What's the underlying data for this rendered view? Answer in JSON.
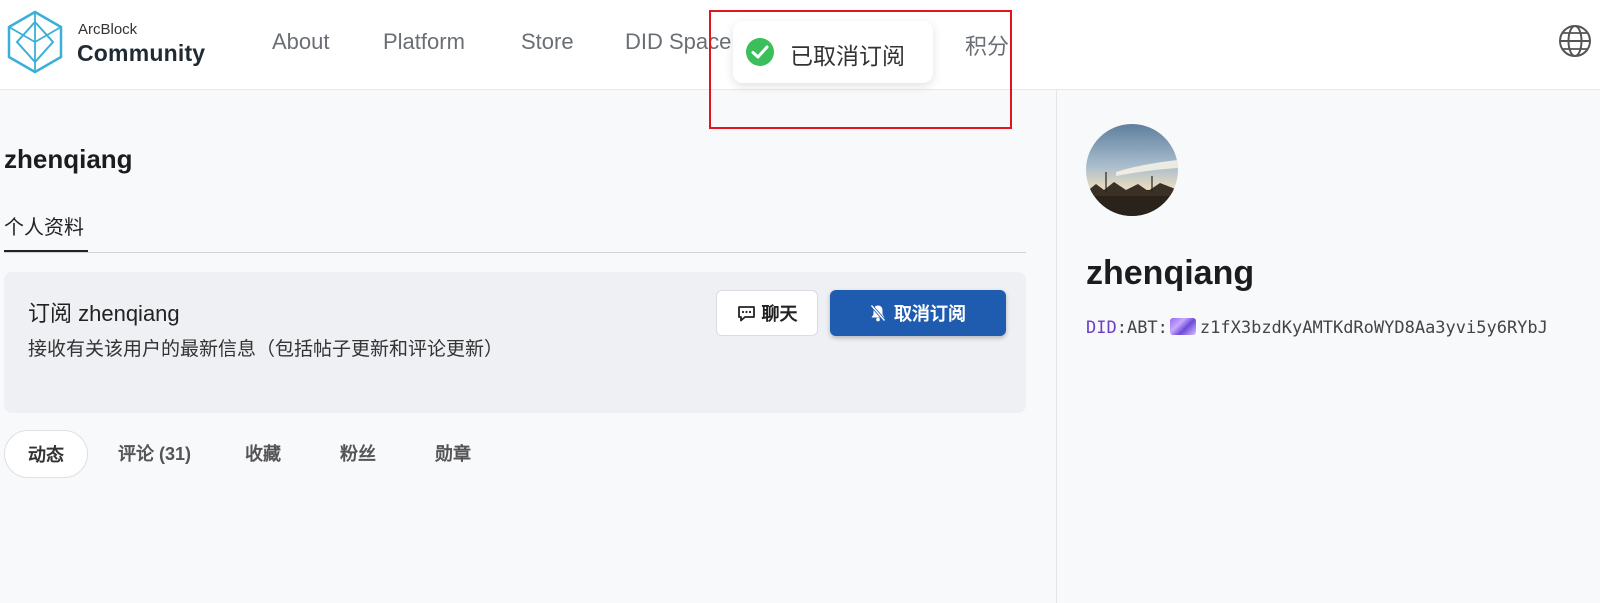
{
  "header": {
    "brand_top": "ArcBlock",
    "brand_bottom": "Community",
    "nav": [
      "About",
      "Platform",
      "Store",
      "DID Space",
      "积分"
    ]
  },
  "toast": {
    "message": "已取消订阅",
    "status_color": "#3bbf5a"
  },
  "profile": {
    "username": "zhenqiang",
    "tab_label": "个人资料"
  },
  "subscription": {
    "title": "订阅 zhenqiang",
    "description": "接收有关该用户的最新信息（包括帖子更新和评论更新）",
    "chat_label": "聊天",
    "unsubscribe_label": "取消订阅"
  },
  "activity_tabs": [
    "动态",
    "评论 (31)",
    "收藏",
    "粉丝",
    "勋章"
  ],
  "sidebar": {
    "name": "zhenqiang",
    "did_prefix": "DID",
    "did_sep": ":ABT:",
    "did_value": "z1fX3bzdKyAMTKdRoWYD8Aa3yvi5y6RYbJ"
  },
  "colors": {
    "accent": "#1f5cb0",
    "highlight": "#e0161e",
    "did_purple": "#6a3ec6"
  }
}
